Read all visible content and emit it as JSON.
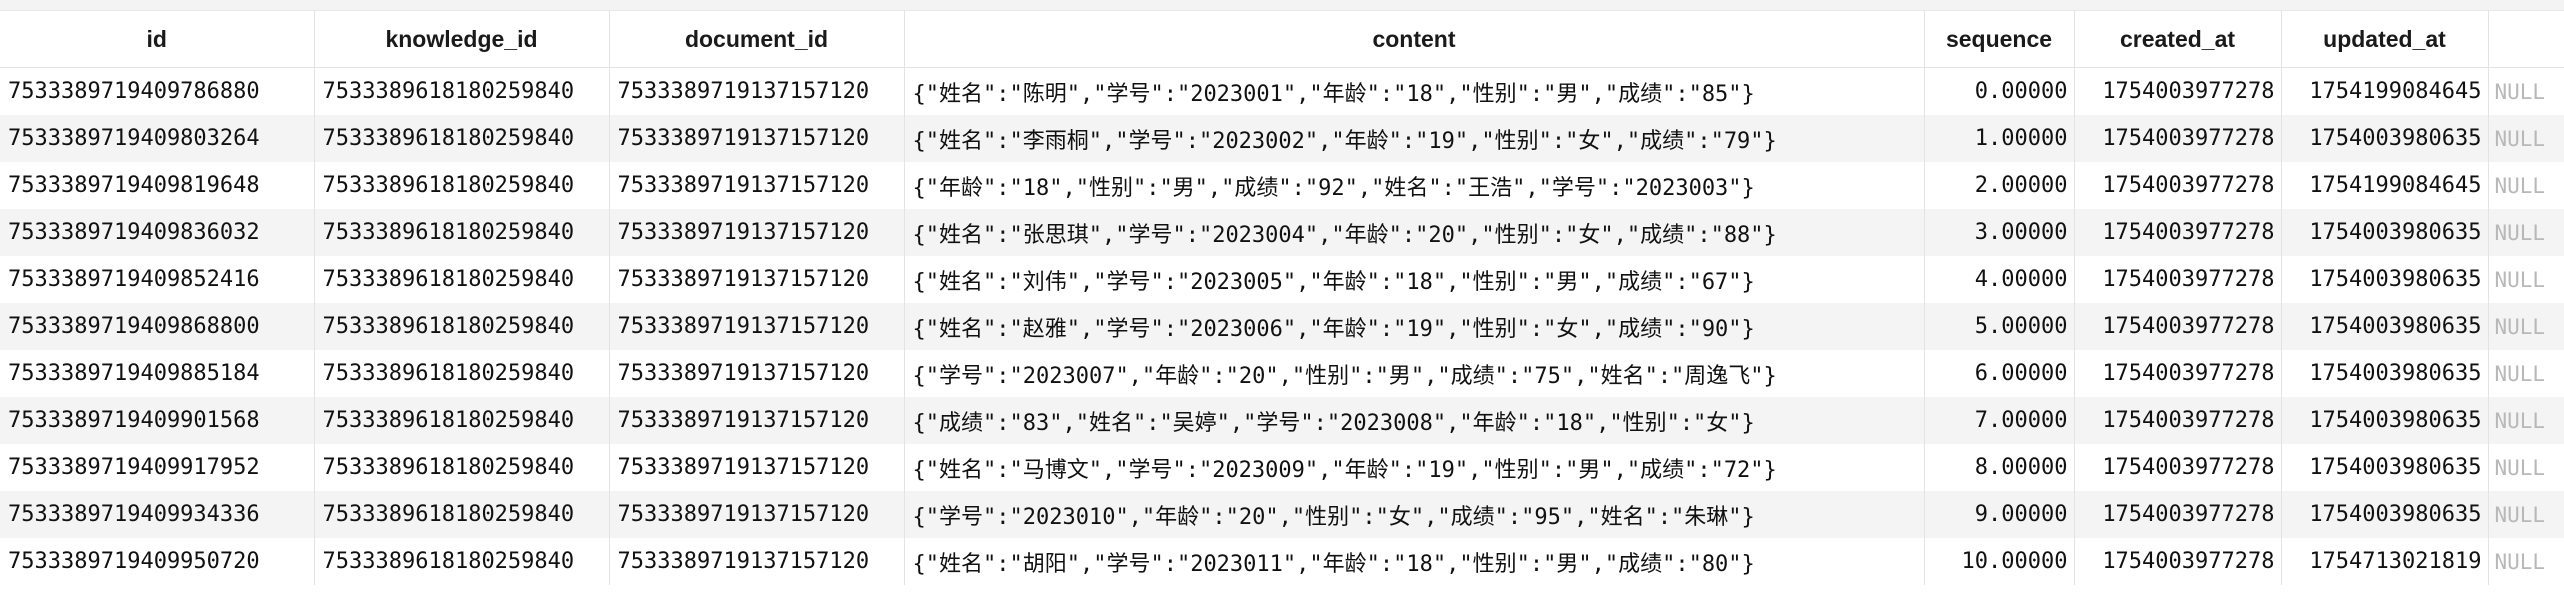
{
  "columns": [
    "id",
    "knowledge_id",
    "document_id",
    "content",
    "sequence",
    "created_at",
    "updated_at",
    ""
  ],
  "rows": [
    {
      "id": "7533389719409786880",
      "knowledge_id": "7533389618180259840",
      "document_id": "7533389719137157120",
      "content": "{\"姓名\":\"陈明\",\"学号\":\"2023001\",\"年龄\":\"18\",\"性别\":\"男\",\"成绩\":\"85\"}",
      "sequence": "0.00000",
      "created_at": "1754003977278",
      "updated_at": "1754199084645",
      "extra": "NULL"
    },
    {
      "id": "7533389719409803264",
      "knowledge_id": "7533389618180259840",
      "document_id": "7533389719137157120",
      "content": "{\"姓名\":\"李雨桐\",\"学号\":\"2023002\",\"年龄\":\"19\",\"性别\":\"女\",\"成绩\":\"79\"}",
      "sequence": "1.00000",
      "created_at": "1754003977278",
      "updated_at": "1754003980635",
      "extra": "NULL"
    },
    {
      "id": "7533389719409819648",
      "knowledge_id": "7533389618180259840",
      "document_id": "7533389719137157120",
      "content": "{\"年龄\":\"18\",\"性别\":\"男\",\"成绩\":\"92\",\"姓名\":\"王浩\",\"学号\":\"2023003\"}",
      "sequence": "2.00000",
      "created_at": "1754003977278",
      "updated_at": "1754199084645",
      "extra": "NULL"
    },
    {
      "id": "7533389719409836032",
      "knowledge_id": "7533389618180259840",
      "document_id": "7533389719137157120",
      "content": "{\"姓名\":\"张思琪\",\"学号\":\"2023004\",\"年龄\":\"20\",\"性别\":\"女\",\"成绩\":\"88\"}",
      "sequence": "3.00000",
      "created_at": "1754003977278",
      "updated_at": "1754003980635",
      "extra": "NULL"
    },
    {
      "id": "7533389719409852416",
      "knowledge_id": "7533389618180259840",
      "document_id": "7533389719137157120",
      "content": "{\"姓名\":\"刘伟\",\"学号\":\"2023005\",\"年龄\":\"18\",\"性别\":\"男\",\"成绩\":\"67\"}",
      "sequence": "4.00000",
      "created_at": "1754003977278",
      "updated_at": "1754003980635",
      "extra": "NULL"
    },
    {
      "id": "7533389719409868800",
      "knowledge_id": "7533389618180259840",
      "document_id": "7533389719137157120",
      "content": "{\"姓名\":\"赵雅\",\"学号\":\"2023006\",\"年龄\":\"19\",\"性别\":\"女\",\"成绩\":\"90\"}",
      "sequence": "5.00000",
      "created_at": "1754003977278",
      "updated_at": "1754003980635",
      "extra": "NULL"
    },
    {
      "id": "7533389719409885184",
      "knowledge_id": "7533389618180259840",
      "document_id": "7533389719137157120",
      "content": "{\"学号\":\"2023007\",\"年龄\":\"20\",\"性别\":\"男\",\"成绩\":\"75\",\"姓名\":\"周逸飞\"}",
      "sequence": "6.00000",
      "created_at": "1754003977278",
      "updated_at": "1754003980635",
      "extra": "NULL"
    },
    {
      "id": "7533389719409901568",
      "knowledge_id": "7533389618180259840",
      "document_id": "7533389719137157120",
      "content": "{\"成绩\":\"83\",\"姓名\":\"吴婷\",\"学号\":\"2023008\",\"年龄\":\"18\",\"性别\":\"女\"}",
      "sequence": "7.00000",
      "created_at": "1754003977278",
      "updated_at": "1754003980635",
      "extra": "NULL"
    },
    {
      "id": "7533389719409917952",
      "knowledge_id": "7533389618180259840",
      "document_id": "7533389719137157120",
      "content": "{\"姓名\":\"马博文\",\"学号\":\"2023009\",\"年龄\":\"19\",\"性别\":\"男\",\"成绩\":\"72\"}",
      "sequence": "8.00000",
      "created_at": "1754003977278",
      "updated_at": "1754003980635",
      "extra": "NULL"
    },
    {
      "id": "7533389719409934336",
      "knowledge_id": "7533389618180259840",
      "document_id": "7533389719137157120",
      "content": "{\"学号\":\"2023010\",\"年龄\":\"20\",\"性别\":\"女\",\"成绩\":\"95\",\"姓名\":\"朱琳\"}",
      "sequence": "9.00000",
      "created_at": "1754003977278",
      "updated_at": "1754003980635",
      "extra": "NULL"
    },
    {
      "id": "7533389719409950720",
      "knowledge_id": "7533389618180259840",
      "document_id": "7533389719137157120",
      "content": "{\"姓名\":\"胡阳\",\"学号\":\"2023011\",\"年龄\":\"18\",\"性别\":\"男\",\"成绩\":\"80\"}",
      "sequence": "10.00000",
      "created_at": "1754003977278",
      "updated_at": "1754713021819",
      "extra": "NULL"
    }
  ]
}
